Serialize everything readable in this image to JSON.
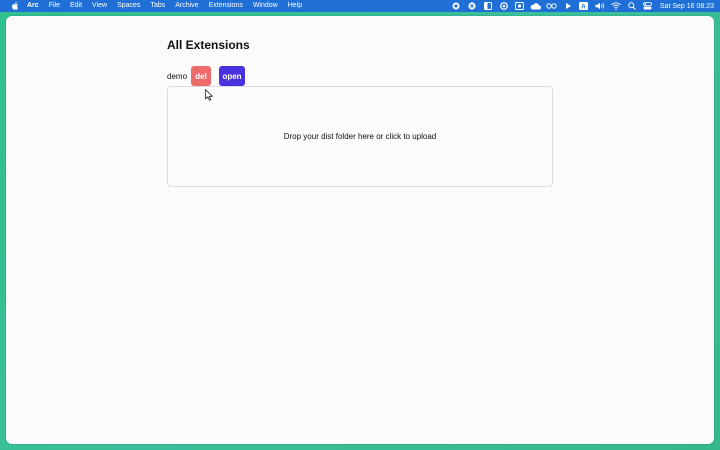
{
  "menubar": {
    "app": "Arc",
    "items": [
      "File",
      "Edit",
      "View",
      "Spaces",
      "Tabs",
      "Archive",
      "Extensions",
      "Window",
      "Help"
    ],
    "datetime": "Sat Sep 16  08:23",
    "status_icons": [
      "record-icon",
      "app-icon",
      "sidebar-icon",
      "circle-icon",
      "screen-icon",
      "cloud-icon",
      "glasses-icon",
      "play-icon",
      "keyboard-a-icon",
      "volume-icon",
      "wifi-icon",
      "search-icon",
      "control-center-icon"
    ],
    "colors": {
      "background": "#1f6fd6",
      "text": "#ffffff"
    }
  },
  "page": {
    "title": "All Extensions",
    "extension": {
      "name": "demo",
      "delete_label": "del",
      "open_label": "open"
    },
    "dropzone_text": "Drop your dist folder here or click to upload"
  },
  "colors": {
    "desktop": "#35b88c",
    "delete_button": "#ee6b6b",
    "open_button": "#4b32e0",
    "window": "#fbfbfc"
  }
}
